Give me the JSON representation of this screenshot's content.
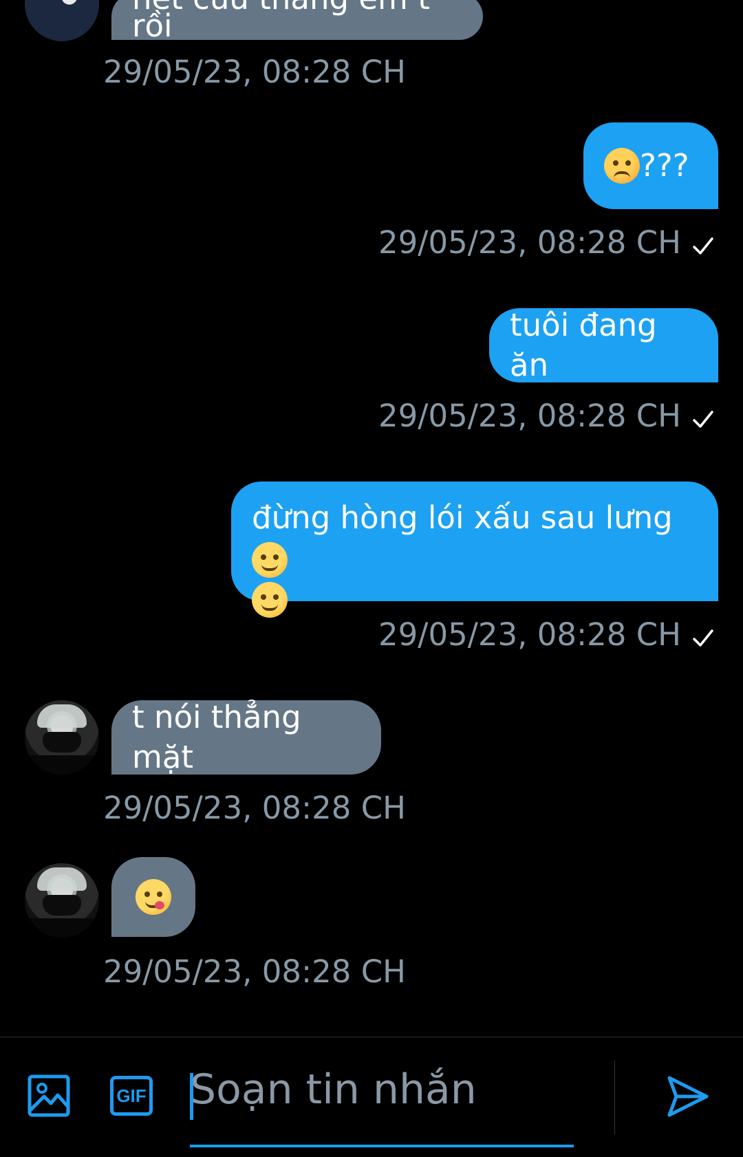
{
  "messages": [
    {
      "text": "hết cứu thằng em t rồi",
      "time": "29/05/23, 08:28 CH"
    },
    {
      "text": "???",
      "time": "29/05/23, 08:28 CH"
    },
    {
      "text": "tuôi đang ăn",
      "time": "29/05/23, 08:28 CH"
    },
    {
      "text": "đừng hòng lói xấu sau lưng",
      "time": "29/05/23, 08:28 CH"
    },
    {
      "text": "t nói thẳng mặt",
      "time": "29/05/23, 08:28 CH"
    },
    {
      "text": "",
      "time": "29/05/23, 08:28 CH"
    }
  ],
  "composer": {
    "placeholder": "Soạn tin nhắn",
    "gif_label": "GIF"
  },
  "colors": {
    "outgoing_bubble": "#1da1f2",
    "incoming_bubble": "#657786",
    "accent": "#1d9bf0",
    "timestamp": "#8899a6"
  },
  "icons": [
    "image-icon",
    "gif-icon",
    "send-icon",
    "check-icon",
    "angry-face-emoji",
    "smirk-face-emoji",
    "yum-face-emoji"
  ]
}
